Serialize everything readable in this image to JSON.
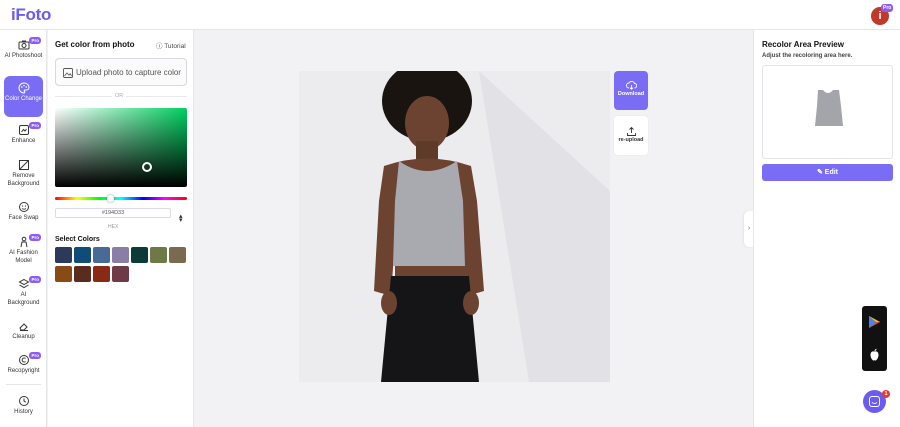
{
  "app": {
    "logo": "iFoto",
    "avatar_initial": "i",
    "avatar_badge": "Pro"
  },
  "sidebar": {
    "items": [
      {
        "label": "AI Photoshoot",
        "icon": "camera-icon",
        "pro": "Pro",
        "active": false
      },
      {
        "label": "Color Change",
        "icon": "palette-icon",
        "pro": "",
        "active": true
      },
      {
        "label": "Enhance",
        "icon": "enhance-icon",
        "pro": "Pro",
        "active": false
      },
      {
        "label": "Remove Background",
        "icon": "remove-bg-icon",
        "pro": "",
        "active": false
      },
      {
        "label": "Face Swap",
        "icon": "face-swap-icon",
        "pro": "",
        "active": false
      },
      {
        "label": "AI Fashion Model",
        "icon": "fashion-model-icon",
        "pro": "Pro",
        "active": false
      },
      {
        "label": "AI Background",
        "icon": "layers-icon",
        "pro": "Pro",
        "active": false
      },
      {
        "label": "Cleanup",
        "icon": "eraser-icon",
        "pro": "",
        "active": false
      },
      {
        "label": "Recopyright",
        "icon": "copyright-icon",
        "pro": "Pro",
        "active": false
      },
      {
        "label": "History",
        "icon": "history-icon",
        "pro": "",
        "active": false
      }
    ]
  },
  "color_panel": {
    "title": "Get color from photo",
    "tutorial": "Tutorial",
    "upload_label": "Upload photo to capture color",
    "or": "OR",
    "hex_value": "#194D33",
    "hex_label": "HEX",
    "select_colors_title": "Select Colors",
    "swatches": [
      "#2b3a5a",
      "#0f4c78",
      "#4a6a96",
      "#8a7ea6",
      "#0b3b36",
      "#6e7a45",
      "#7a6b50",
      "#8a4a14",
      "#5a2c1e",
      "#8a2a14",
      "#6e3a48"
    ]
  },
  "canvas": {
    "download_label": "Download",
    "reupload_label": "re-upload"
  },
  "right_panel": {
    "title": "Recolor Area Preview",
    "subtitle": "Adjust the recoloring area here.",
    "edit_label": "Edit"
  },
  "chat": {
    "badge": "1"
  },
  "colors": {
    "accent": "#7b6cf6",
    "logo": "#6a5cf0"
  }
}
